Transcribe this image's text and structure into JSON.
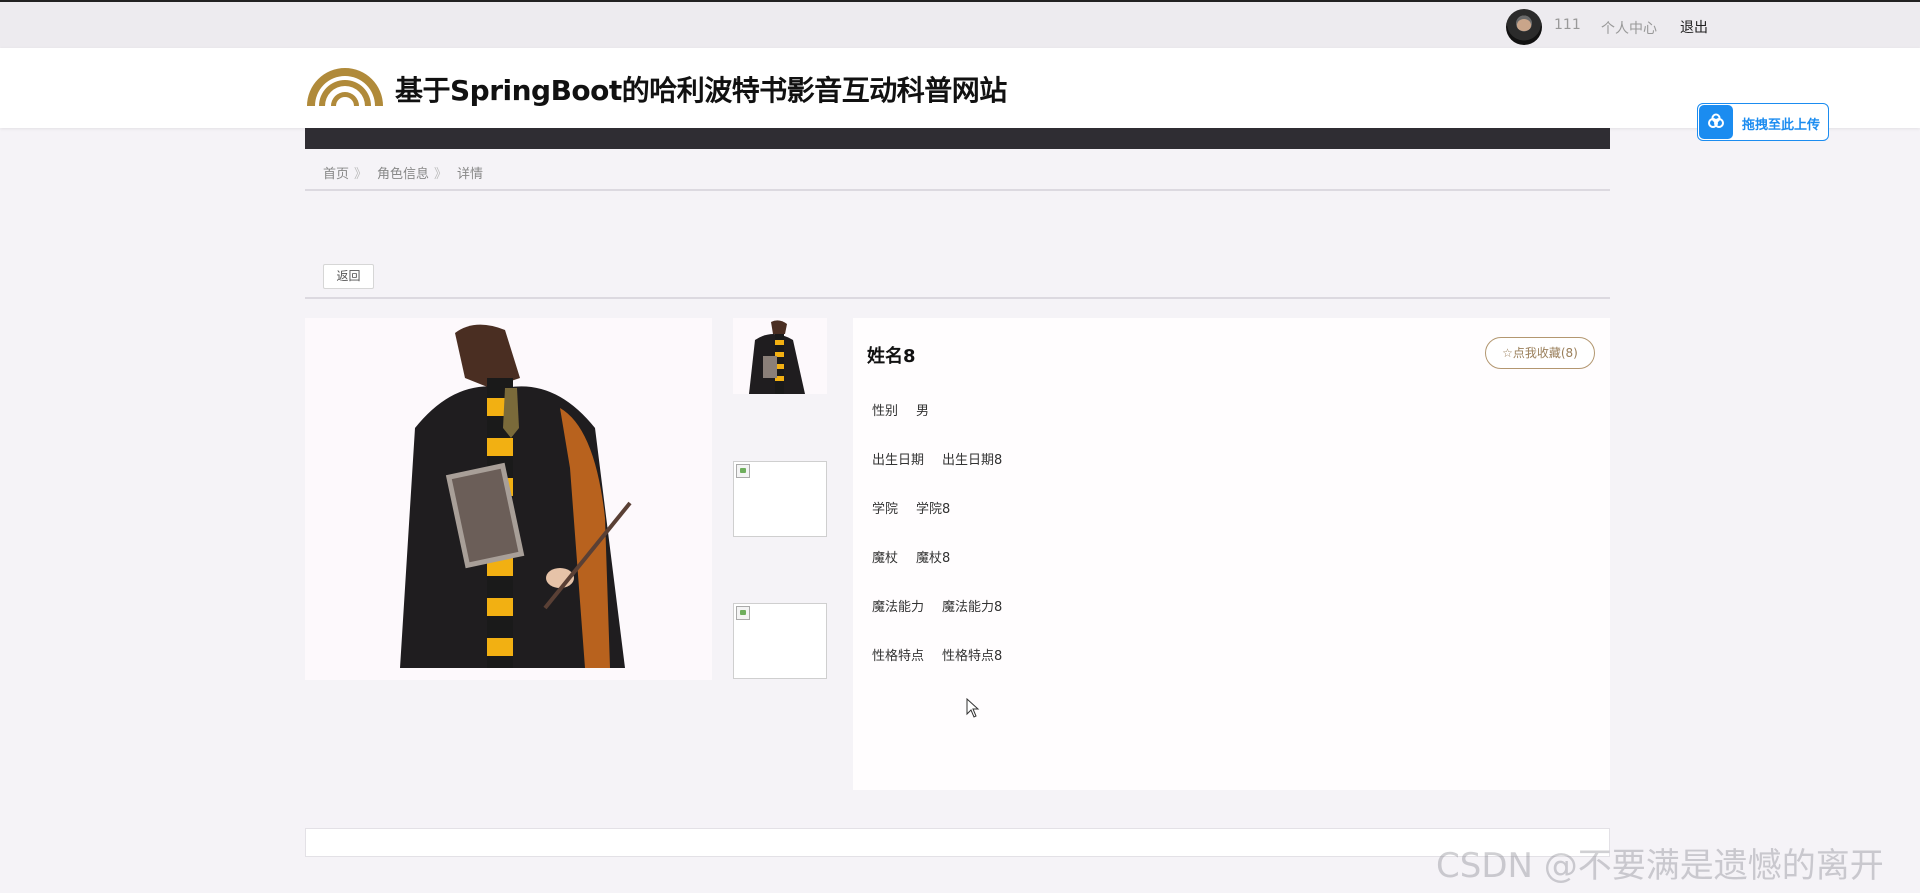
{
  "account": {
    "username": "111",
    "center_label": "个人中心",
    "logout_label": "退出"
  },
  "header": {
    "site_title": "基于SpringBoot的哈利波特书影音互动科普网站",
    "brand_color": "#b08a3a"
  },
  "upload_widget": {
    "label": "拖拽至此上传",
    "icon": "cloud-icon",
    "color": "#1b8cf0"
  },
  "breadcrumb": {
    "items": [
      "首页",
      "角色信息",
      "详情"
    ],
    "separator": "》"
  },
  "actions": {
    "back_label": "返回"
  },
  "detail": {
    "name": "姓名8",
    "favorite_label": "☆点我收藏(8)",
    "fields": [
      {
        "label": "性别",
        "value": "男"
      },
      {
        "label": "出生日期",
        "value": "出生日期8"
      },
      {
        "label": "学院",
        "value": "学院8"
      },
      {
        "label": "魔杖",
        "value": "魔杖8"
      },
      {
        "label": "魔法能力",
        "value": "魔法能力8"
      },
      {
        "label": "性格特点",
        "value": "性格特点8"
      }
    ]
  },
  "watermark": "CSDN @不要满是遗憾的离开"
}
